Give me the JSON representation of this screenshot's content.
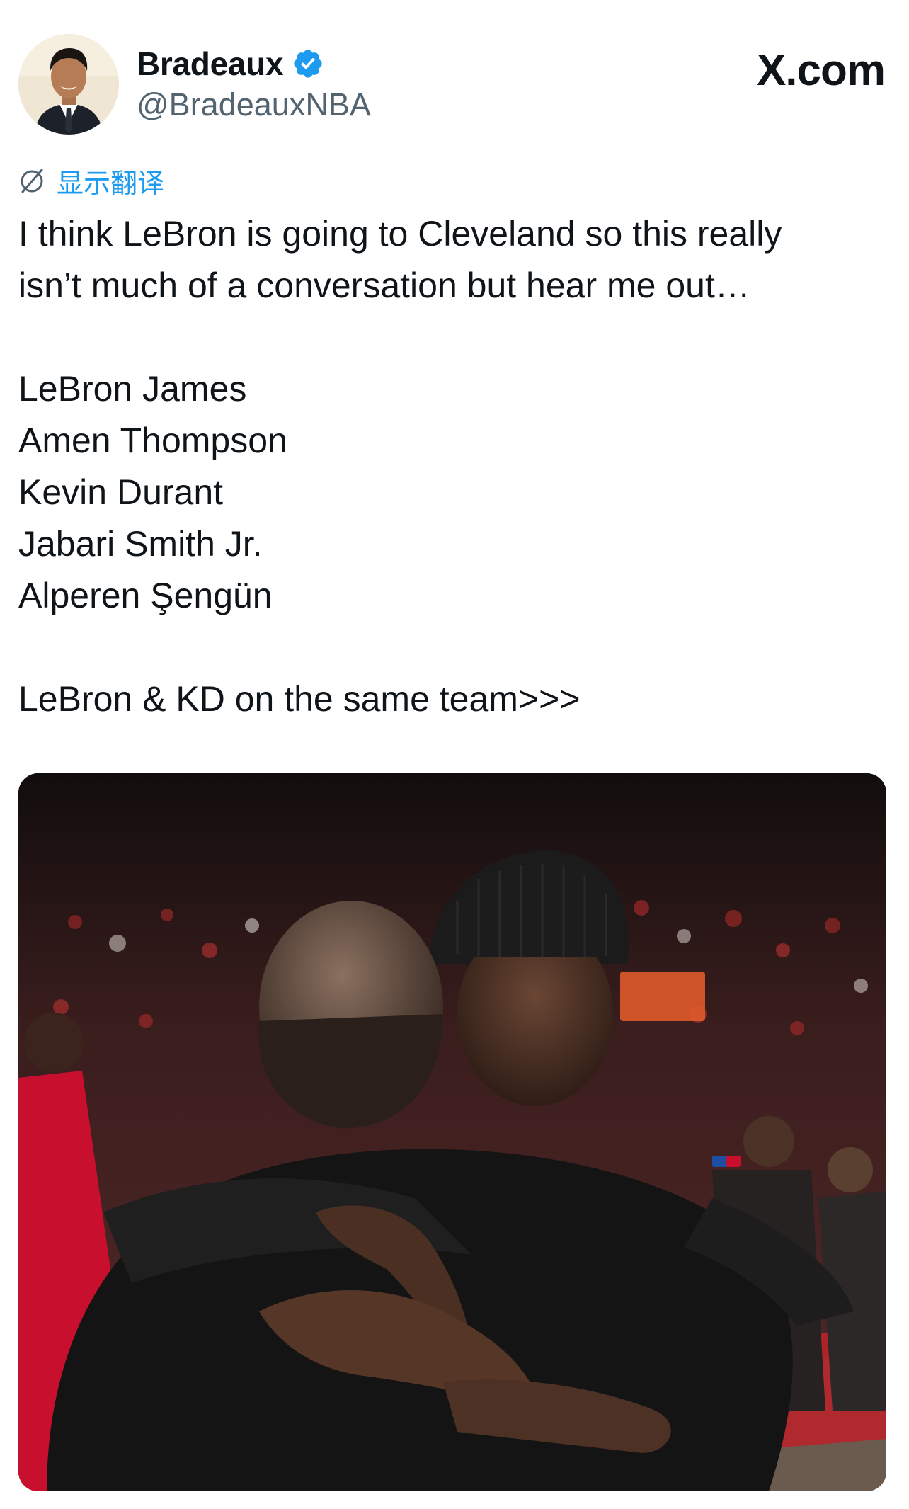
{
  "author": {
    "display_name": "Bradeaux",
    "handle": "@BradeauxNBA",
    "verified": true,
    "avatar_icon": "profile-photo"
  },
  "brand": {
    "label": "X.com"
  },
  "translate": {
    "label": "显示翻译",
    "icon": "translate-globe-icon",
    "color": "#1d9bf0"
  },
  "tweet": {
    "intro_line_1": "I think LeBron is going to Cleveland so this really",
    "intro_line_2": "isn’t much of a conversation but hear me out…",
    "lineup": [
      "LeBron James",
      "Amen Thompson",
      "Kevin Durant",
      "Jabari Smith Jr.",
      "Alperen Şengün"
    ],
    "closing": "LeBron & KD on the same team>>>"
  },
  "media": {
    "icon": "photo-two-men-embracing-on-basketball-court"
  },
  "colors": {
    "text": "#0f1419",
    "secondary": "#536471",
    "accent": "#1d9bf0",
    "rockets_red": "#c8102e"
  }
}
